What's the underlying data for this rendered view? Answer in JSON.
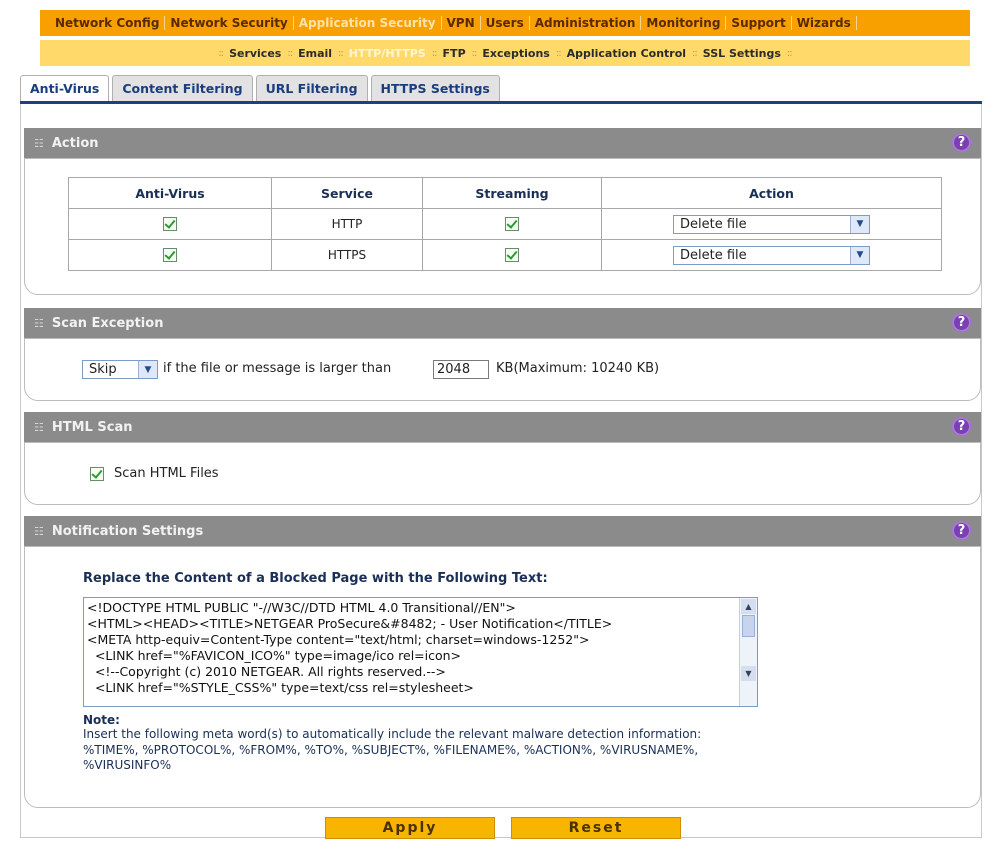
{
  "top_nav": [
    "Network Config",
    "Network Security",
    "Application Security",
    "VPN",
    "Users",
    "Administration",
    "Monitoring",
    "Support",
    "Wizards"
  ],
  "top_nav_active": "Application Security",
  "sub_nav": [
    "Services",
    "Email",
    "HTTP/HTTPS",
    "FTP",
    "Exceptions",
    "Application Control",
    "SSL Settings"
  ],
  "sub_nav_active": "HTTP/HTTPS",
  "tabs": [
    "Anti-Virus",
    "Content Filtering",
    "URL Filtering",
    "HTTPS Settings"
  ],
  "tab_active": "Anti-Virus",
  "action": {
    "title": "Action",
    "headers": [
      "Anti-Virus",
      "Service",
      "Streaming",
      "Action"
    ],
    "rows": [
      {
        "antivirus": true,
        "service": "HTTP",
        "streaming": true,
        "action": "Delete file"
      },
      {
        "antivirus": true,
        "service": "HTTPS",
        "streaming": true,
        "action": "Delete file"
      }
    ]
  },
  "scan_exception": {
    "title": "Scan Exception",
    "mode": "Skip",
    "text": "if the file or message is larger than",
    "size": "2048",
    "unit_text": "KB(Maximum: 10240 KB)"
  },
  "html_scan": {
    "title": "HTML Scan",
    "checkbox_label": "Scan HTML Files",
    "checked": true
  },
  "notification": {
    "title": "Notification Settings",
    "heading": "Replace the Content of a Blocked Page with the Following Text:",
    "lines": [
      "<!DOCTYPE HTML PUBLIC \"-//W3C//DTD HTML 4.0 Transitional//EN\">",
      "<HTML><HEAD><TITLE>NETGEAR ProSecure&#8482; - User Notification</TITLE>",
      "<META http-equiv=Content-Type content=\"text/html; charset=windows-1252\">",
      "  <LINK href=\"%FAVICON_ICO%\" type=image/ico rel=icon>",
      "  <!--Copyright (c) 2010 NETGEAR. All rights reserved.-->",
      "  <LINK href=\"%STYLE_CSS%\" type=text/css rel=stylesheet>"
    ],
    "note_label": "Note:",
    "note_text": "Insert the following meta word(s) to automatically include the relevant malware detection information:",
    "note_words_1": "%TIME%, %PROTOCOL%, %FROM%, %TO%, %SUBJECT%, %FILENAME%, %ACTION%, %VIRUSNAME%,",
    "note_words_2": "%VIRUSINFO%"
  },
  "buttons": {
    "apply": "Apply",
    "reset": "Reset"
  },
  "help_glyph": "?",
  "colors": {
    "orange": "#f7a000",
    "yellow": "#ffd96a",
    "section_header": "#8b8b8b",
    "help": "#7a3fb0",
    "button": "#f7b500"
  }
}
